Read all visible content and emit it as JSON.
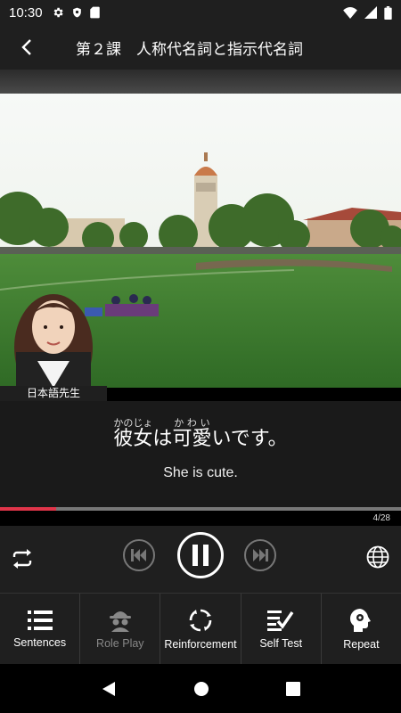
{
  "status": {
    "time": "10:30"
  },
  "header": {
    "title": "第２課　人称代名詞と指示代名詞"
  },
  "video": {
    "teacher_label": "日本語先生"
  },
  "lesson": {
    "segments": [
      {
        "text": "彼女",
        "ruby": "かのじょ"
      },
      {
        "text": "は",
        "ruby": ""
      },
      {
        "text": "可愛",
        "ruby": "かわい"
      },
      {
        "text": "いです。",
        "ruby": ""
      }
    ],
    "translation": "She is cute."
  },
  "progress": {
    "current": 4,
    "total": 28,
    "label": "4/28",
    "fraction": 0.14,
    "accent": "#e0354a"
  },
  "tabs": [
    {
      "label": "Sentences",
      "icon": "list-icon",
      "enabled": true
    },
    {
      "label": "Role Play",
      "icon": "spy-icon",
      "enabled": false
    },
    {
      "label": "Reinforcement",
      "icon": "cycle-icon",
      "enabled": true
    },
    {
      "label": "Self Test",
      "icon": "checklist-icon",
      "enabled": true
    },
    {
      "label": "Repeat",
      "icon": "head-gear-icon",
      "enabled": true
    }
  ]
}
